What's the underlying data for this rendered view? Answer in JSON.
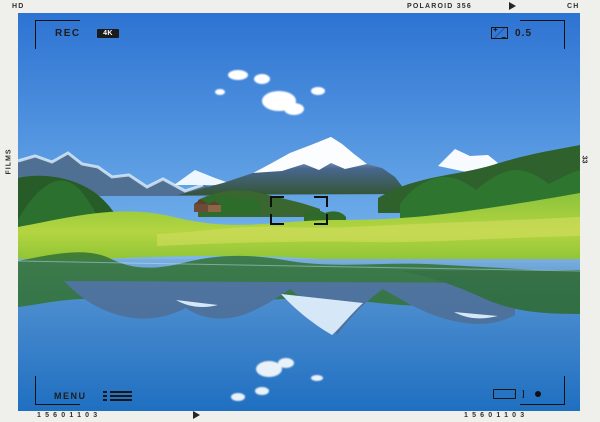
{
  "film": {
    "top_left": "HD",
    "top_center": "POLAROID 356",
    "top_right": "CH",
    "side_left": "FILMS",
    "side_right": "33",
    "bottom_left_number": "15601103",
    "bottom_right_number": "15601103"
  },
  "viewfinder": {
    "recording_label": "REC",
    "quality_badge": "4K",
    "exposure_value": "0.5",
    "menu_label": "MENU"
  },
  "icons": {
    "exposure": "exposure-compensation-icon",
    "menu": "menu-list-icon",
    "camera": "video-camera-icon",
    "arrow": "play-arrow-icon"
  },
  "scene": {
    "sky_color": "#5aa4e8",
    "water_color": "#2f82c8",
    "meadow_color": "#9fcb35",
    "forest_color": "#2f6d28"
  }
}
